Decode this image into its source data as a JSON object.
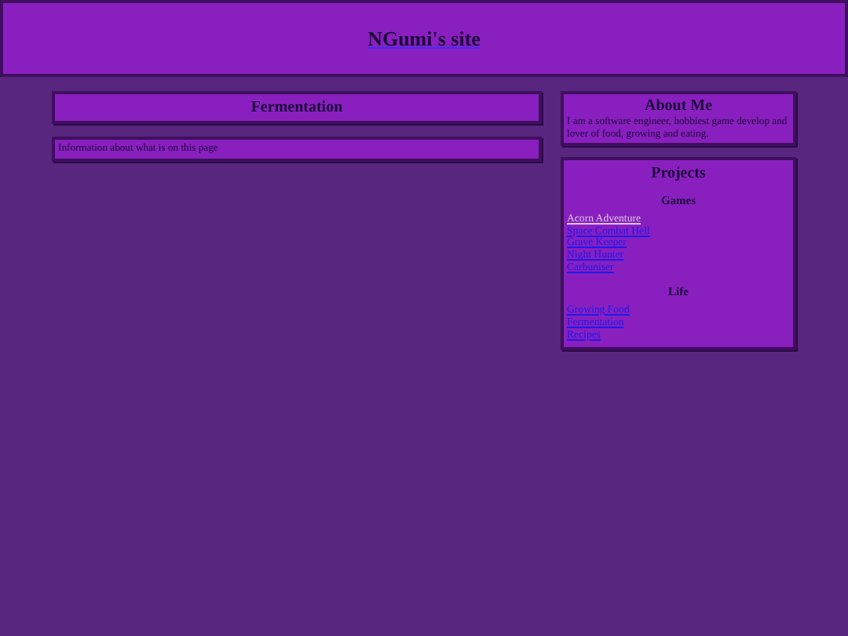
{
  "header": {
    "title": "NGumi's site"
  },
  "main": {
    "title": "Fermentation",
    "intro": "Information about what is on this page"
  },
  "about": {
    "title": "About Me",
    "text": "I am a software engineer, hobbiest game develop and lover of food, growing and eating."
  },
  "projects": {
    "title": "Projects",
    "groups": [
      {
        "title": "Games",
        "links": [
          {
            "label": "Acorn Adventure",
            "visited": true
          },
          {
            "label": "Space Combat Hell",
            "visited": false
          },
          {
            "label": "Grave Keeper",
            "visited": false
          },
          {
            "label": "Night Hunter",
            "visited": false
          },
          {
            "label": "Carbuniser",
            "visited": false
          }
        ]
      },
      {
        "title": "Life",
        "links": [
          {
            "label": "Growing Food",
            "visited": false
          },
          {
            "label": "Fermentation",
            "visited": false
          },
          {
            "label": "Recipes",
            "visited": false
          }
        ]
      }
    ]
  }
}
